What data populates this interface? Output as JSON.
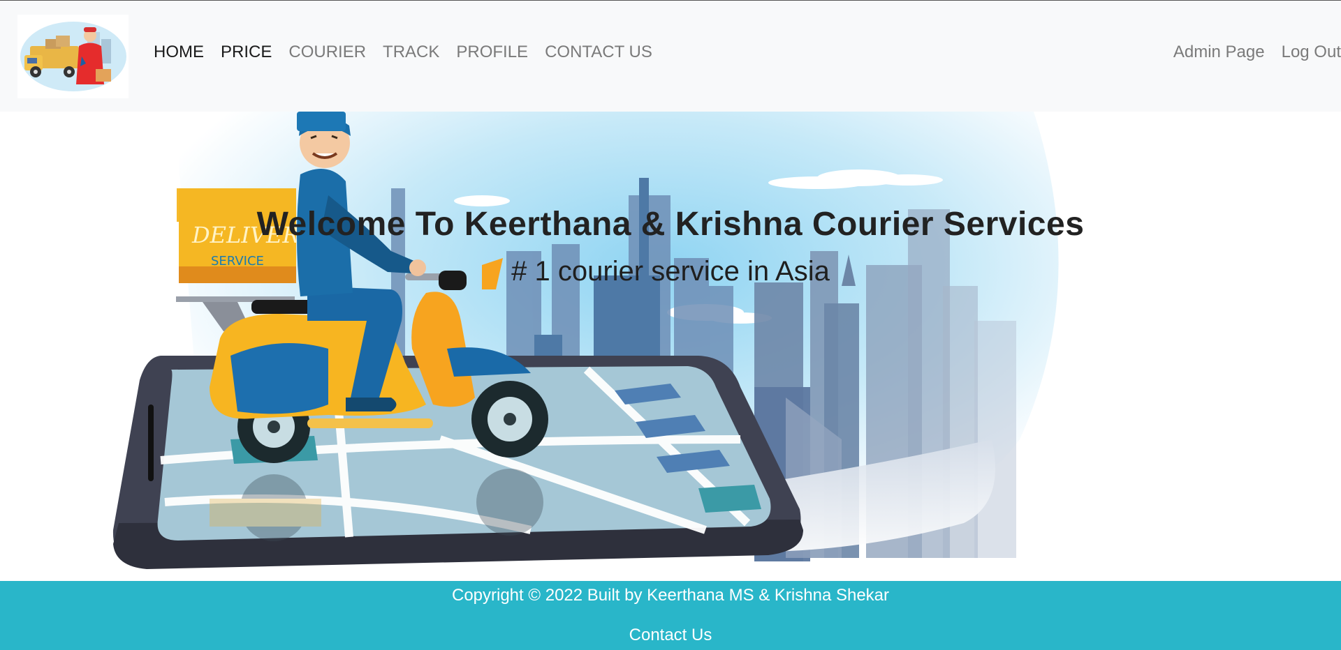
{
  "navbar": {
    "links": [
      {
        "label": "HOME",
        "active": true
      },
      {
        "label": "PRICE",
        "active": true
      },
      {
        "label": "COURIER",
        "active": false
      },
      {
        "label": "TRACK",
        "active": false
      },
      {
        "label": "PROFILE",
        "active": false
      },
      {
        "label": "CONTACT US",
        "active": false
      }
    ],
    "right_links": [
      {
        "label": "Admin Page"
      },
      {
        "label": "Log Out"
      }
    ]
  },
  "hero": {
    "title": "Welcome To Keerthana & Krishna Courier Services",
    "subtitle": "# 1 courier service in Asia",
    "delivery_box_text_1": "DELIVERY",
    "delivery_box_text_2": "SERVICE"
  },
  "footer": {
    "copyright": "Copyright © 2022 Built by Keerthana MS & Krishna Shekar",
    "contact": "Contact Us"
  },
  "colors": {
    "navbar_bg": "#f8f9fa",
    "footer_bg": "#29b6c9",
    "active_link": "#1a1a1a",
    "inactive_link": "#7a7a7a",
    "title_text": "#222222"
  }
}
